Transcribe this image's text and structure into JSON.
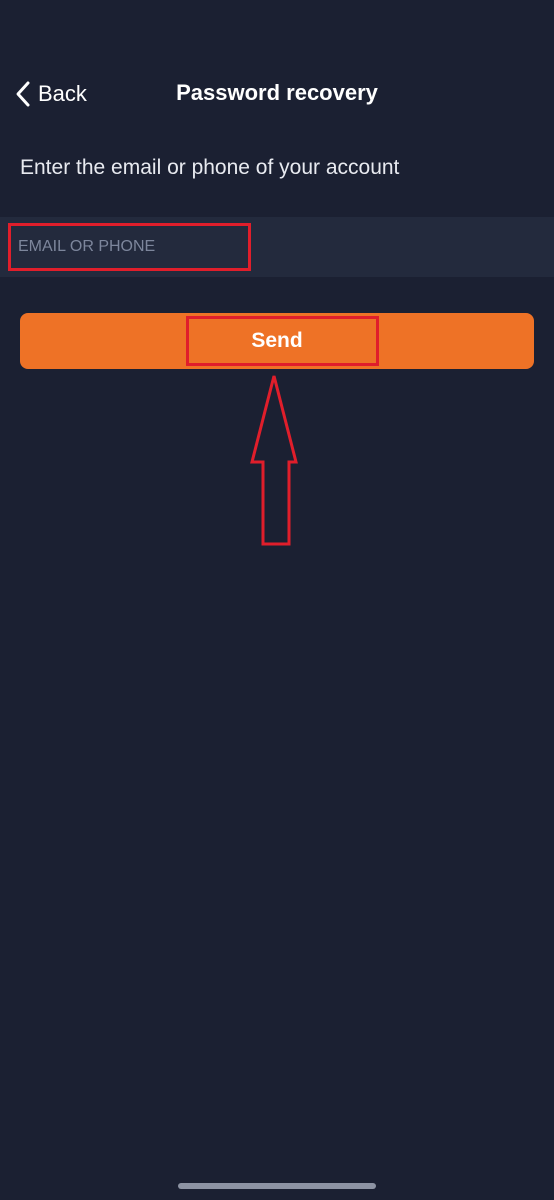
{
  "nav": {
    "back_label": "Back",
    "back_icon": "chevron-left-icon",
    "title": "Password recovery"
  },
  "form": {
    "instruction": "Enter the email or phone of your account",
    "email_placeholder": "EMAIL OR PHONE",
    "email_value": "",
    "send_label": "Send"
  },
  "colors": {
    "background": "#1b2032",
    "input_background": "#232a3d",
    "accent": "#ee7226",
    "annotation": "#e01e2b",
    "text": "#ffffff",
    "placeholder": "#7d869c"
  }
}
